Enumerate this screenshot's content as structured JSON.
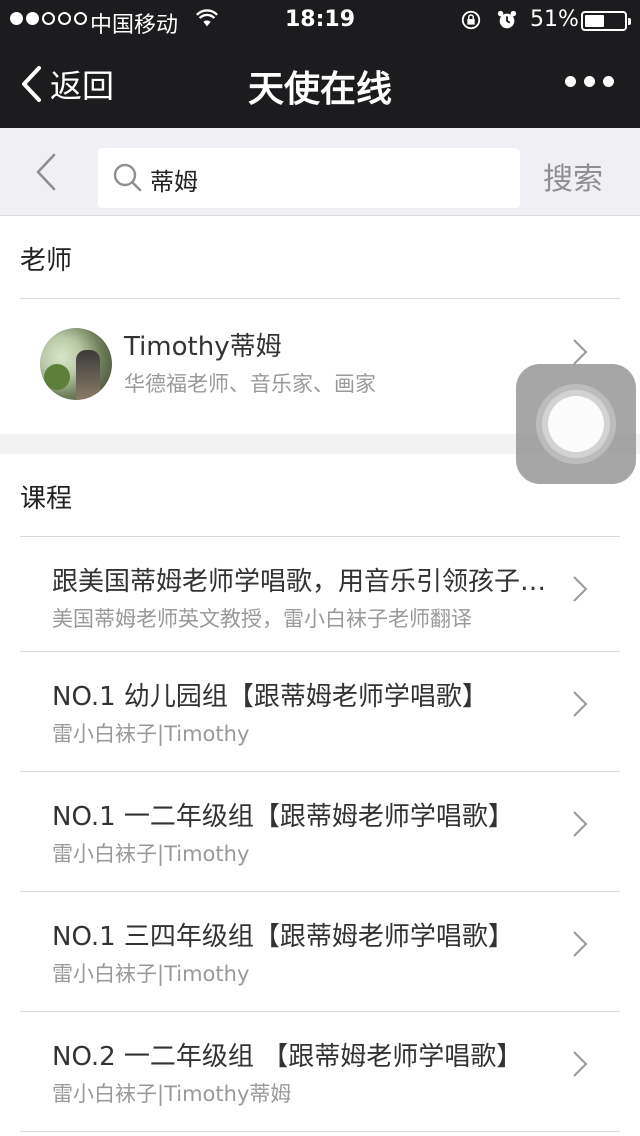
{
  "status_bar": {
    "carrier": "中国移动",
    "time": "18:19",
    "battery_percent_label": "51%",
    "battery_level": 0.51,
    "signal_strength": 2,
    "icons": [
      "signal-dots",
      "wifi-icon",
      "rotation-lock-icon",
      "alarm-icon",
      "battery-icon"
    ]
  },
  "nav": {
    "back_label": "返回",
    "title": "天使在线",
    "more_icon": "more-dots-icon"
  },
  "search": {
    "query": "蒂姆",
    "button_label": "搜索"
  },
  "teachers_section": {
    "header": "老师",
    "items": [
      {
        "name": "Timothy蒂姆",
        "description": "华德福老师、音乐家、画家"
      }
    ]
  },
  "courses_section": {
    "header": "课程",
    "items": [
      {
        "title": "跟美国蒂姆老师学唱歌，用音乐引领孩子走进英语世界",
        "subtitle": "美国蒂姆老师英文教授，雷小白袜子老师翻译"
      },
      {
        "title": "NO.1 幼儿园组【跟蒂姆老师学唱歌】",
        "subtitle": "雷小白袜子|Timothy"
      },
      {
        "title": "NO.1 一二年级组【跟蒂姆老师学唱歌】",
        "subtitle": "雷小白袜子|Timothy"
      },
      {
        "title": "NO.1 三四年级组【跟蒂姆老师学唱歌】",
        "subtitle": "雷小白袜子|Timothy"
      },
      {
        "title": "NO.2 一二年级组 【跟蒂姆老师学唱歌】",
        "subtitle": "雷小白袜子|Timothy蒂姆"
      }
    ]
  },
  "colors": {
    "nav_bg": "#1c1c1e",
    "search_bg": "#efeff4",
    "primary_text": "#333333",
    "secondary_text": "#9a9a9a"
  }
}
